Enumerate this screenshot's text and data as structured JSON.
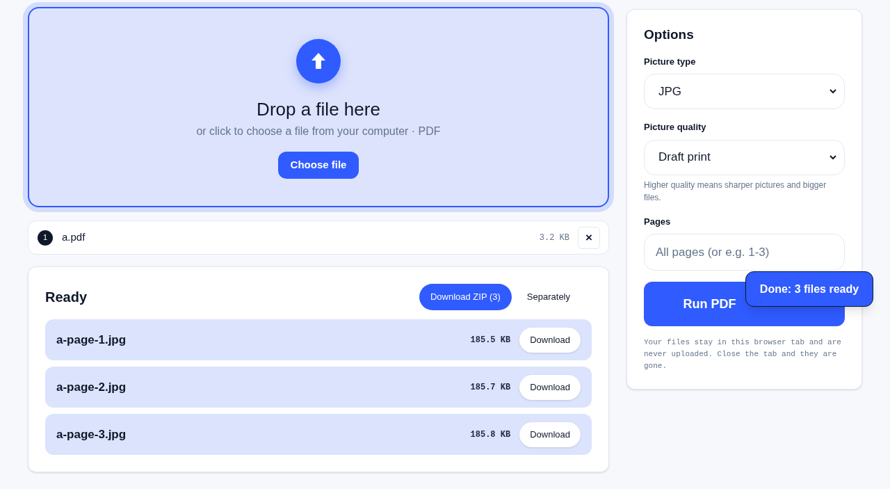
{
  "dropzone": {
    "title": "Drop a file here",
    "subtitle": "or click to choose a file from your computer · PDF",
    "button": "Choose file"
  },
  "file": {
    "index": "1",
    "name": "a.pdf",
    "size": "3.2 KB",
    "remove": "×"
  },
  "results": {
    "title": "Ready",
    "modes": [
      {
        "label": "Download ZIP (3)",
        "selected": true
      },
      {
        "label": "Separately",
        "selected": false
      }
    ],
    "files": [
      {
        "name": "a-page-1.jpg",
        "size": "185.5 KB",
        "button": "Download"
      },
      {
        "name": "a-page-2.jpg",
        "size": "185.7 KB",
        "button": "Download"
      },
      {
        "name": "a-page-3.jpg",
        "size": "185.8 KB",
        "button": "Download"
      }
    ]
  },
  "options": {
    "title": "Options",
    "picture_type": {
      "label": "Picture type",
      "value": "JPG"
    },
    "picture_quality": {
      "label": "Picture quality",
      "value": "Draft print",
      "hint": "Higher quality means sharper pictures and bigger files."
    },
    "pages": {
      "label": "Pages",
      "placeholder": "All pages (or e.g. 1-3)"
    },
    "run_button": "Run PDF",
    "note": "Your files stay in this browser tab and are never uploaded. Close the tab and they are gone."
  },
  "toast": "Done: 3 files ready"
}
